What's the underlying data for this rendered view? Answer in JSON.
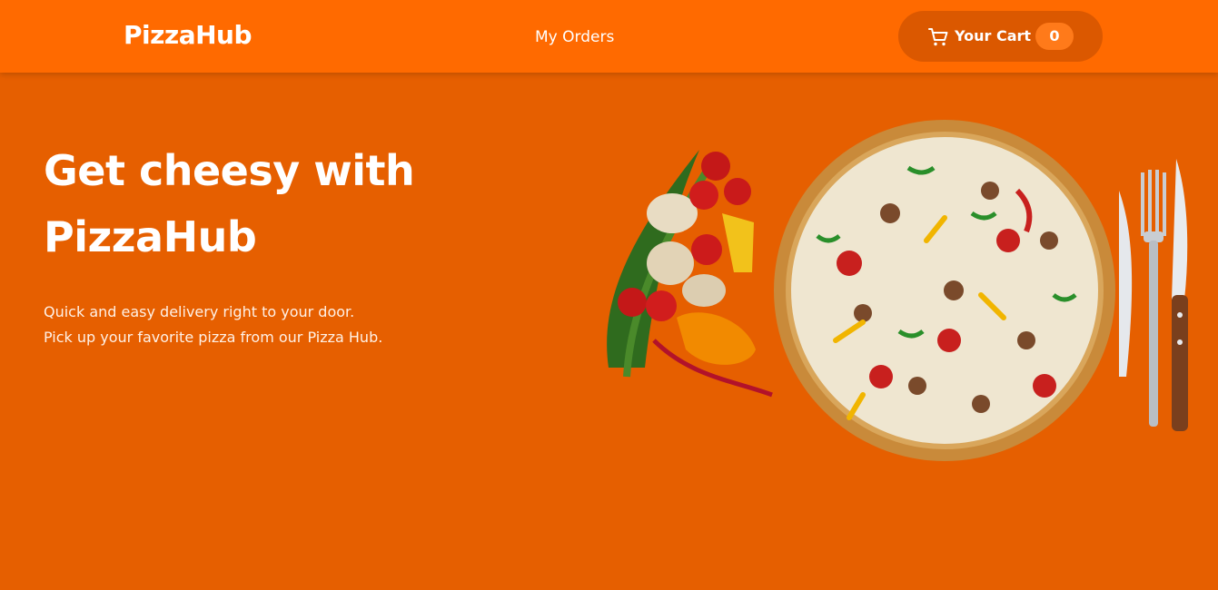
{
  "header": {
    "brand": "PizzaHub",
    "nav": {
      "orders_label": "My Orders"
    },
    "cart": {
      "label": "Your Cart",
      "count": "0",
      "icon": "cart-icon"
    }
  },
  "hero": {
    "title": "Get cheesy with PizzaHub",
    "subtitle_line1": "Quick and easy delivery right to your door.",
    "subtitle_line2": "Pick up your favorite pizza from our Pizza Hub."
  },
  "colors": {
    "header_bg": "#ff6a00",
    "page_bg": "#e65f00",
    "cart_bg": "#db5800",
    "badge_bg": "#ff7a1a"
  }
}
